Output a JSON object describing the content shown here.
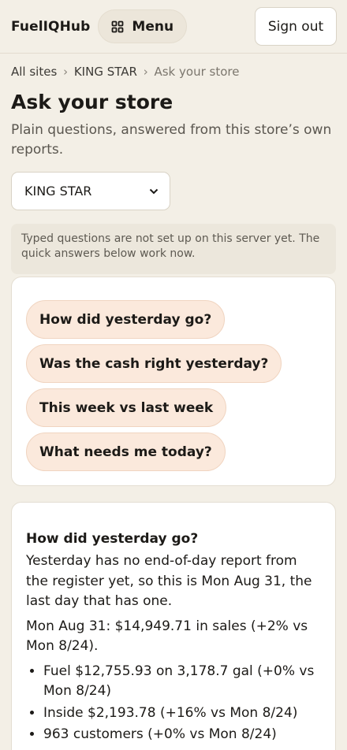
{
  "header": {
    "brand": "FuelIQHub",
    "menu_label": "Menu",
    "signout_label": "Sign out"
  },
  "breadcrumb": {
    "items": [
      "All sites",
      "KING STAR",
      "Ask your store"
    ],
    "separator": "›"
  },
  "page": {
    "title": "Ask your store",
    "subtitle": "Plain questions, answered from this store’s own reports."
  },
  "store_select": {
    "value": "KING STAR"
  },
  "notice": "Typed questions are not set up on this server yet. The quick answers below work now.",
  "quick_questions": [
    "How did yesterday go?",
    "Was the cash right yesterday?",
    "This week vs last week",
    "What needs me today?"
  ],
  "answer": {
    "title": "How did yesterday go?",
    "intro": "Yesterday has no end-of-day report from the register yet, so this is Mon Aug 31, the last day that has one.",
    "summary": "Mon Aug 31: $14,949.71 in sales (+2% vs Mon 8/24).",
    "bullets": [
      "Fuel $12,755.93 on 3,178.7 gal (+0% vs Mon 8/24)",
      "Inside $2,193.78 (+16% vs Mon 8/24)",
      "963 customers (+0% vs Mon 8/24)"
    ]
  },
  "colors": {
    "background": "#f3efe6",
    "chip_fill": "#fbe9dc",
    "card": "#ffffff",
    "notice": "#ece7dc"
  }
}
